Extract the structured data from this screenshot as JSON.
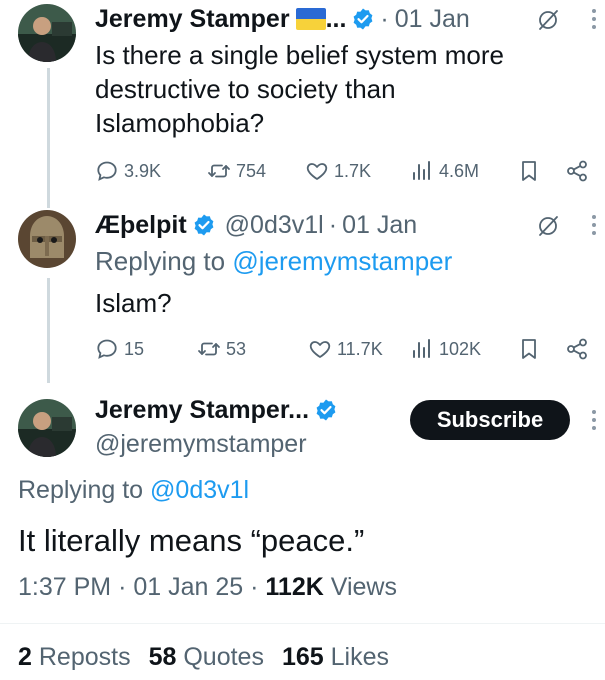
{
  "tweet1": {
    "name": "Jeremy Stamper",
    "ellipsis": "...",
    "time": "01 Jan",
    "text_lines": [
      "Is there a single belief system more",
      "destructive to society than",
      "Islamophobia?"
    ],
    "stats": {
      "replies": "3.9K",
      "reposts": "754",
      "likes": "1.7K",
      "views": "4.6M"
    }
  },
  "tweet2": {
    "name": "Æþelpit",
    "handle": "@0d3v1l",
    "time": "01 Jan",
    "replying_prefix": "Replying to",
    "replying_handle": "@jeremymstamper",
    "text": "Islam?",
    "stats": {
      "replies": "15",
      "reposts": "53",
      "likes": "11.7K",
      "views": "102K"
    }
  },
  "tweet3": {
    "name": "Jeremy Stamper...",
    "handle": "@jeremymstamper",
    "subscribe_label": "Subscribe",
    "replying_prefix": "Replying to",
    "replying_handle": "@0d3v1l",
    "text": "It literally means “peace.”",
    "time": "1:37 PM",
    "date": "01 Jan 25",
    "views_count": "112K",
    "views_label": "Views",
    "reposts_count": "2",
    "reposts_label": "Reposts",
    "quotes_count": "58",
    "quotes_label": "Quotes",
    "likes_count": "165",
    "likes_label": "Likes"
  },
  "colors": {
    "accent": "#1d9bf0",
    "text": "#0f1419",
    "muted": "#536471"
  },
  "icons": [
    "reply-icon",
    "repost-icon",
    "like-icon",
    "views-icon",
    "bookmark-icon",
    "share-icon",
    "grok-icon",
    "more-icon",
    "verified-badge-icon",
    "ukraine-flag-icon"
  ]
}
